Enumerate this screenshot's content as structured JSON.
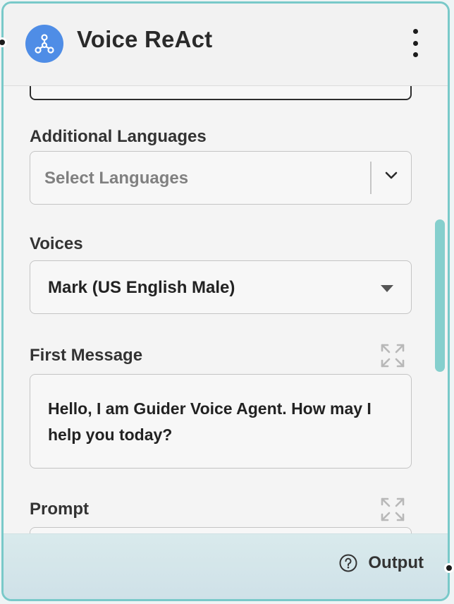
{
  "node": {
    "title": "Voice ReAct",
    "icon": "workflow-icon",
    "accent_color": "#79c9c9",
    "logo_color": "#4f8de6"
  },
  "additional_languages": {
    "label": "Additional Languages",
    "placeholder": "Select Languages"
  },
  "voices": {
    "label": "Voices",
    "selected": "Mark (US English Male)"
  },
  "first_message": {
    "label": "First Message",
    "value": "Hello, I am Guider Voice Agent. How may I help you today?"
  },
  "prompt": {
    "label": "Prompt"
  },
  "footer": {
    "output_label": "Output",
    "icon": "help-circle-icon"
  }
}
